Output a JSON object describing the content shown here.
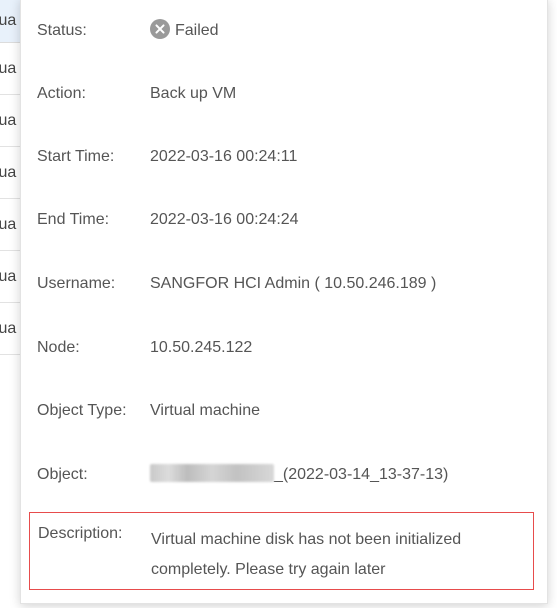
{
  "background_table": {
    "rows": [
      "tua",
      "tua",
      "tua",
      "tua",
      "tua",
      "tua",
      "tua"
    ]
  },
  "popup": {
    "status": {
      "label": "Status:",
      "value": "Failed",
      "icon": "failed-x-icon"
    },
    "action": {
      "label": "Action:",
      "value": "Back up VM"
    },
    "start_time": {
      "label": "Start Time:",
      "value": "2022-03-16 00:24:11"
    },
    "end_time": {
      "label": "End Time:",
      "value": "2022-03-16 00:24:24"
    },
    "username": {
      "label": "Username:",
      "value": "SANGFOR HCI Admin ( 10.50.246.189 )"
    },
    "node": {
      "label": "Node:",
      "value": "10.50.245.122"
    },
    "object_type": {
      "label": "Object Type:",
      "value": "Virtual machine"
    },
    "object": {
      "label": "Object:",
      "value_suffix": "_(2022-03-14_13-37-13)"
    },
    "description": {
      "label": "Description:",
      "value": "Virtual machine disk has not been initialized completely. Please try again later"
    }
  },
  "colors": {
    "highlight_border": "#e74c4c",
    "status_icon": "#9a9a9a",
    "table_header": "#e8f1fb"
  }
}
